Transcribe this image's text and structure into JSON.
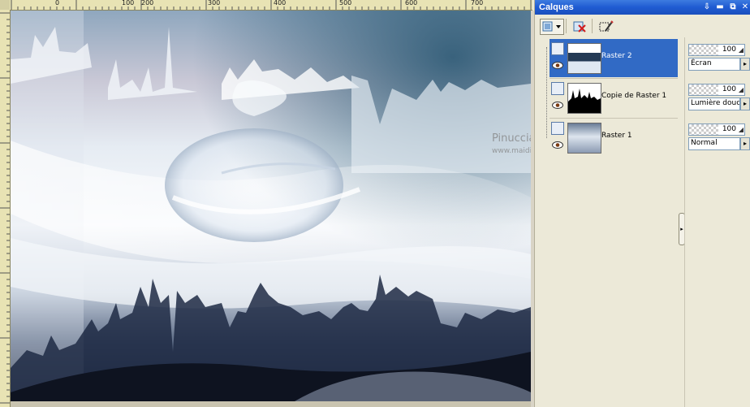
{
  "ruler": {
    "labels": [
      "0",
      "100",
      "200",
      "300",
      "400",
      "500",
      "600",
      "700"
    ]
  },
  "panel": {
    "title": "Calques",
    "titlebar_buttons": {
      "pin": "⇩",
      "minimize": "▬",
      "restore": "⧉",
      "close": "✕"
    },
    "toolbar_icons": [
      "new-layer-icon",
      "dropdown-arrow-icon",
      "delete-layer-icon",
      "edit-selection-icon"
    ]
  },
  "layers": [
    {
      "name": "Raster 2",
      "selected": true,
      "visible": true,
      "opacity": "100",
      "blend_mode": "Écran"
    },
    {
      "name": "Copie de Raster 1",
      "selected": false,
      "visible": true,
      "opacity": "100",
      "blend_mode": "Lumière douce"
    },
    {
      "name": "Raster 1",
      "selected": false,
      "visible": true,
      "opacity": "100",
      "blend_mode": "Normal"
    }
  ],
  "watermark": {
    "line1": "Pinuccia",
    "line2": "www.maidiregrafica.eu"
  },
  "colors": {
    "titlebar": "#1f5bd2",
    "selection": "#316ac5",
    "panel_bg": "#ece9d8",
    "ruler_bg": "#e8e3b4"
  }
}
